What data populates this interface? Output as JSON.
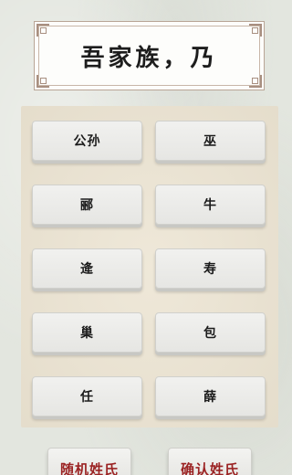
{
  "title": "吾家族，乃",
  "surnames": [
    "公孙",
    "巫",
    "郦",
    "牛",
    "逄",
    "寿",
    "巢",
    "包",
    "任",
    "薛"
  ],
  "buttons": {
    "random": "随机姓氏",
    "confirm": "确认姓氏"
  },
  "colors": {
    "panel": "#ece4d2",
    "button_text_accent": "#9b2323"
  }
}
